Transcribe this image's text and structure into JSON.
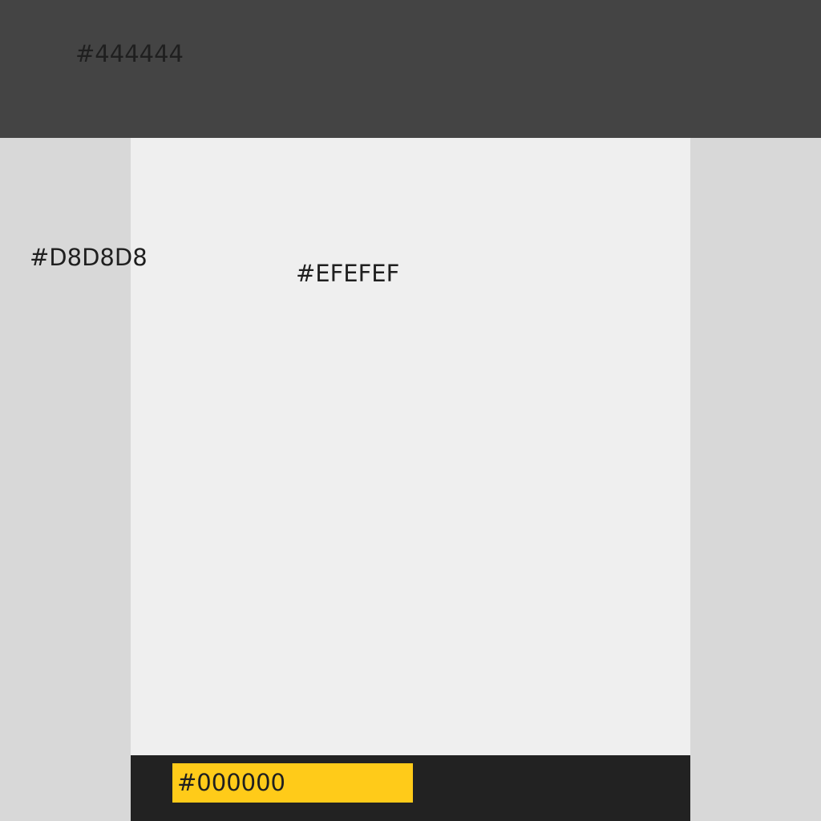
{
  "header": {
    "label": "#444444",
    "color": "#444444"
  },
  "sidebar": {
    "label": "#D8D8D8",
    "color": "#D8D8D8"
  },
  "main": {
    "label": "#EFEFEF",
    "color": "#EFEFEF"
  },
  "footer": {
    "color": "#222222",
    "highlight": {
      "label": "#000000",
      "color": "#FFCB19"
    }
  }
}
